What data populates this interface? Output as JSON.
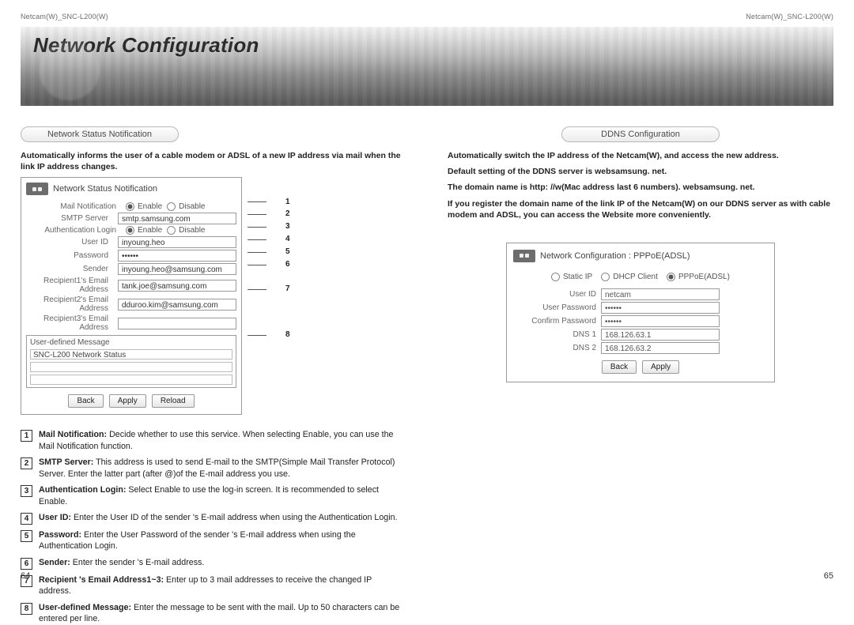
{
  "header": {
    "doc": "Netcam(W)_SNC-L200(W)",
    "banner_title": "Network Configuration"
  },
  "left": {
    "section_title": "Network Status Notification",
    "intro": "Automatically informs the user of a cable modem or ADSL of a new IP address via mail when the link IP address changes.",
    "panel": {
      "title": "Network Status Notification",
      "rows": {
        "mail_notification_label": "Mail Notification",
        "enable": "Enable",
        "disable": "Disable",
        "smtp_label": "SMTP Server",
        "smtp_value": "smtp.samsung.com",
        "auth_label": "Authentication Login",
        "userid_label": "User ID",
        "userid_value": "inyoung.heo",
        "password_label": "Password",
        "password_value": "••••••",
        "sender_label": "Sender",
        "sender_value": "inyoung.heo@samsung.com",
        "r1_label": "Recipient1's Email Address",
        "r1_value": "tank.joe@samsung.com",
        "r2_label": "Recipient2's Email Address",
        "r2_value": "dduroo.kim@samsung.com",
        "r3_label": "Recipient3's Email Address",
        "r3_value": "",
        "usermsg_header": "User-defined Message",
        "usermsg_value": "SNC-L200 Network Status"
      },
      "buttons": {
        "back": "Back",
        "apply": "Apply",
        "reload": "Reload"
      }
    },
    "callout_numbers": [
      "1",
      "2",
      "3",
      "4",
      "5",
      "6",
      "7",
      "8"
    ],
    "defs": [
      {
        "n": "1",
        "title": "Mail Notification:",
        "body": " Decide whether to use this service. When selecting Enable, you can use the Mail Notification function."
      },
      {
        "n": "2",
        "title": "SMTP Server:",
        "body": " This address is used to send E-mail to the SMTP(Simple Mail Transfer Protocol) Server. Enter the latter part (after @)of the E-mail address you use."
      },
      {
        "n": "3",
        "title": "Authentication Login:",
        "body": " Select Enable to use the log-in screen. It is recommended to select Enable."
      },
      {
        "n": "4",
        "title": "User ID:",
        "body": " Enter the User ID of the sender 's E-mail address when using the Authentication Login."
      },
      {
        "n": "5",
        "title": "Password:",
        "body": " Enter the User Password of the sender 's E-mail address when using the Authentication Login."
      },
      {
        "n": "6",
        "title": "Sender:",
        "body": " Enter the sender 's E-mail address."
      },
      {
        "n": "7",
        "title": "Recipient 's Email Address1~3:",
        "body": " Enter up to 3 mail addresses to receive the changed IP address."
      },
      {
        "n": "8",
        "title": "User-defined Message:",
        "body": " Enter the message to be sent with the mail. Up to 50 characters can be entered per line."
      }
    ],
    "page_number": "64"
  },
  "right": {
    "section_title": "DDNS Configuration",
    "intro": [
      "Automatically switch the IP address of the Netcam(W), and access the new address.",
      "Default setting of the DDNS server is websamsung. net.",
      "The domain name is http: //w(Mac address last 6 numbers). websamsung. net.",
      "If you register the domain name of the link IP of the Netcam(W) on our DDNS server as with cable modem and ADSL, you can access the Website more conveniently."
    ],
    "panel": {
      "title": "Network Configuration : PPPoE(ADSL)",
      "radios": {
        "static": "Static IP",
        "dhcp": "DHCP Client",
        "pppoe": "PPPoE(ADSL)"
      },
      "rows": {
        "userid_label": "User ID",
        "userid_value": "netcam",
        "pw_label": "User Password",
        "pw_value": "••••••",
        "cpw_label": "Confirm Password",
        "cpw_value": "••••••",
        "dns1_label": "DNS 1",
        "dns1_value": "168.126.63.1",
        "dns2_label": "DNS 2",
        "dns2_value": "168.126.63.2"
      },
      "buttons": {
        "back": "Back",
        "apply": "Apply"
      }
    },
    "page_number": "65"
  }
}
